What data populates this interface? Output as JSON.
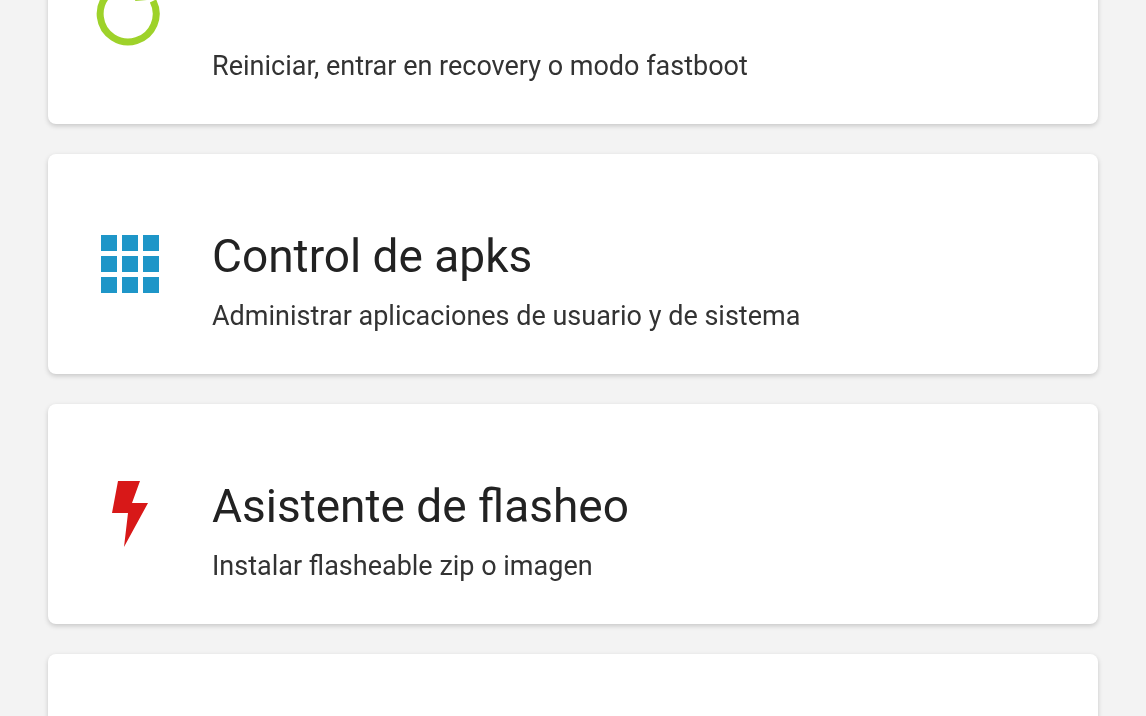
{
  "cards": [
    {
      "kind": "restart",
      "subtitle": "Reiniciar, entrar en recovery o modo fastboot"
    },
    {
      "kind": "apps",
      "title": "Control de apks",
      "subtitle": "Administrar aplicaciones de usuario y de sistema"
    },
    {
      "kind": "flash",
      "title": "Asistente de flasheo",
      "subtitle": "Instalar flasheable zip o imagen"
    },
    {
      "kind": "blank"
    }
  ]
}
